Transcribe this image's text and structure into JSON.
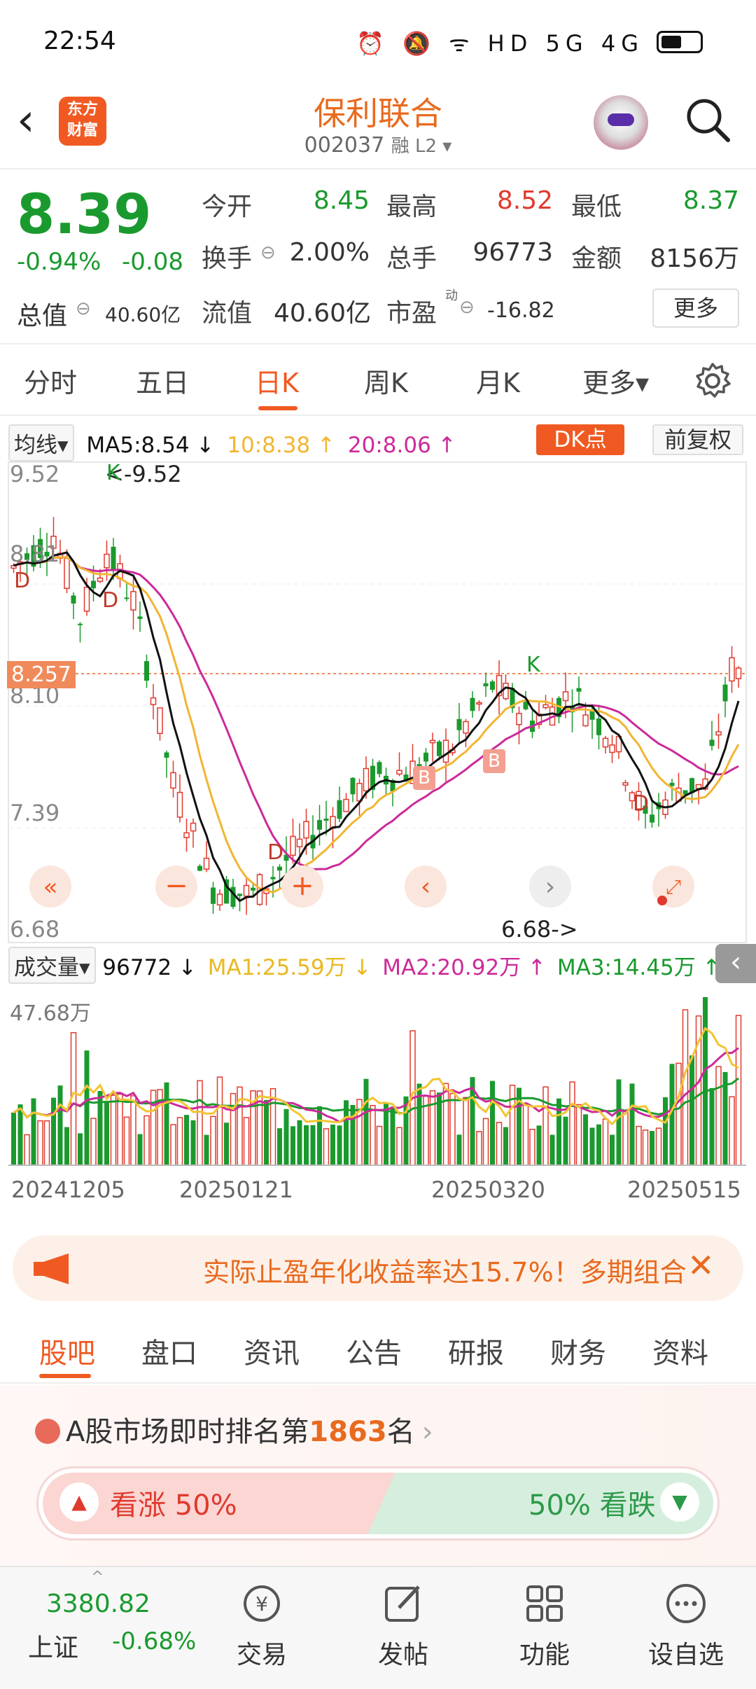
{
  "status": {
    "time": "22:54",
    "icons": "⏰ 🔕 ᯤ HD 5G 4G"
  },
  "header": {
    "logo": "东方财富",
    "title": "保利联合",
    "code": "002037",
    "badges": "融 L2 ▾"
  },
  "quote": {
    "price": "8.39",
    "change_pct": "-0.94%",
    "change": "-0.08",
    "open_label": "今开",
    "open": "8.45",
    "high_label": "最高",
    "high": "8.52",
    "low_label": "最低",
    "low": "8.37",
    "turnover_label": "换手",
    "turnover": "2.00%",
    "volume_label": "总手",
    "volume": "96773",
    "amount_label": "金额",
    "amount": "8156万",
    "mktcap_label": "总值",
    "mktcap": "40.60亿",
    "float_label": "流值",
    "float": "40.60亿",
    "pe_label": "市盈",
    "pe_sup": "动",
    "pe": "-16.82",
    "more": "更多"
  },
  "tabs": [
    "分时",
    "五日",
    "日K",
    "周K",
    "月K",
    "更多▾"
  ],
  "chart": {
    "ma_label": "均线▾",
    "ma5": "MA5:8.54 ↓",
    "ma10": "10:8.38 ↑",
    "ma20": "20:8.06 ↑",
    "dk": "DK点",
    "fq": "前复权",
    "yticks": [
      "9.52",
      "8.81",
      "8.10",
      "7.39",
      "6.68"
    ],
    "cur_price_tag": "8.257",
    "high_label": "<-9.52",
    "low_label": "6.68->",
    "vol_label": "成交量▾",
    "vol_val": "96772 ↓",
    "vol_ma1": "MA1:25.59万 ↓",
    "vol_ma2": "MA2:20.92万 ↑",
    "vol_ma3": "MA3:14.45万 ↑",
    "vol_max": "47.68万",
    "dates": [
      "20241205",
      "20250121",
      "20250320",
      "20250515"
    ],
    "marks": [
      "K",
      "D",
      "D",
      "D",
      "D",
      "B",
      "B",
      "K",
      "D"
    ]
  },
  "banner": {
    "text": "实际止盈年化收益率达15.7%！多期组合"
  },
  "subtabs": [
    "股吧",
    "盘口",
    "资讯",
    "公告",
    "研报",
    "财务",
    "资料"
  ],
  "rank": {
    "prefix": "A股市场即时排名第",
    "num": "1863",
    "suffix": "名"
  },
  "vote": {
    "up": "看涨 50%",
    "down": "50% 看跌"
  },
  "bottom": {
    "index_val": "3380.82",
    "index_name": "上证",
    "index_chg": "-0.68%",
    "nav": [
      "交易",
      "发帖",
      "功能",
      "设自选"
    ]
  },
  "colors": {
    "up": "#e03a2e",
    "down": "#1a9a2e",
    "accent": "#f05a22"
  }
}
